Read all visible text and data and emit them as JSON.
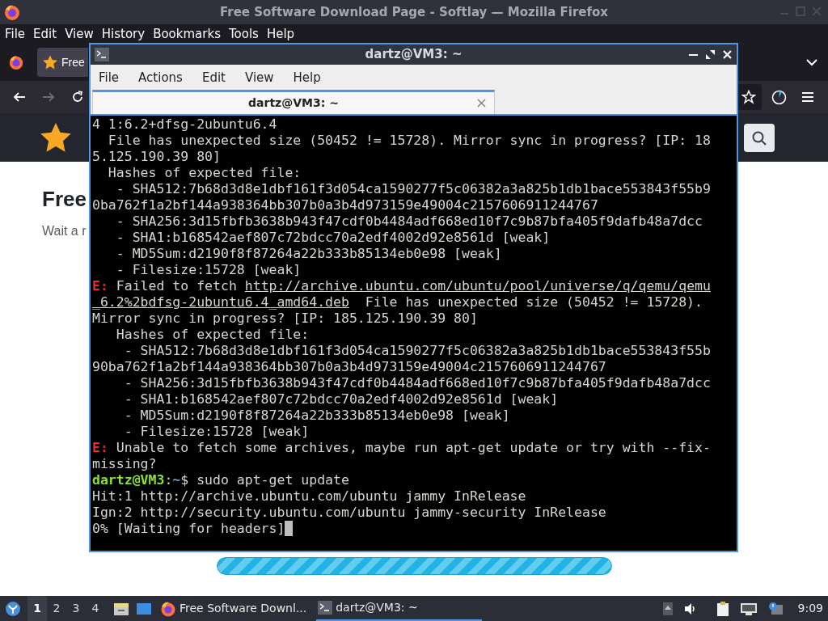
{
  "firefox": {
    "title": "Free Software Download Page - Softlay — Mozilla Firefox",
    "menu": [
      "File",
      "Edit",
      "View",
      "History",
      "Bookmarks",
      "Tools",
      "Help"
    ],
    "tab": {
      "label": "Free"
    },
    "page": {
      "heading": "Free",
      "text": "Wait a r",
      "progress": {
        "level": 1
      }
    }
  },
  "terminal": {
    "title": "dartz@VM3: ~",
    "menu": [
      "File",
      "Actions",
      "Edit",
      "View",
      "Help"
    ],
    "tabs": [
      {
        "label": "dartz@VM3: ~",
        "selected": true
      }
    ],
    "lines": [
      {
        "segments": [
          {
            "kind": "text",
            "text": "4 1:6.2+dfsg-2ubuntu6.4"
          }
        ]
      },
      {
        "segments": [
          {
            "kind": "text",
            "text": "  File has unexpected size (50452 != 15728). Mirror sync in progress? [IP: 18"
          }
        ]
      },
      {
        "segments": [
          {
            "kind": "text",
            "text": "5.125.190.39 80]"
          }
        ]
      },
      {
        "segments": [
          {
            "kind": "text",
            "text": "  Hashes of expected file:"
          }
        ]
      },
      {
        "segments": [
          {
            "kind": "text",
            "text": "   - SHA512:7b68d3d8e1dbf161f3d054ca1590277f5c06382a3a825b1db1bace553843f55b9"
          }
        ]
      },
      {
        "segments": [
          {
            "kind": "text",
            "text": "0ba762f1a2bf144a938364bb307b0a3b4d973159e49004c2157606911244767"
          }
        ]
      },
      {
        "segments": [
          {
            "kind": "text",
            "text": "   - SHA256:3d15fbfb3638b943f47cdf0b4484adf668ed10f7c9b87bfa405f9dafb48a7dcc"
          }
        ]
      },
      {
        "segments": [
          {
            "kind": "text",
            "text": "   - SHA1:b168542aef807c72bdcc70a2edf4002d92e8561d [weak]"
          }
        ]
      },
      {
        "segments": [
          {
            "kind": "text",
            "text": "   - MD5Sum:d2190f8f87264a22b333b85134eb0e98 [weak]"
          }
        ]
      },
      {
        "segments": [
          {
            "kind": "text",
            "text": "   - Filesize:15728 [weak]"
          }
        ]
      },
      {
        "segments": [
          {
            "kind": "error",
            "text": "E:"
          },
          {
            "kind": "text",
            "text": " Failed to fetch "
          },
          {
            "kind": "link",
            "text": "http://archive.ubuntu.com/ubuntu/pool/universe/q/qemu/qemu"
          }
        ]
      },
      {
        "segments": [
          {
            "kind": "link",
            "text": "_6.2%2bdfsg-2ubuntu6.4_amd64.deb"
          },
          {
            "kind": "text",
            "text": "  File has unexpected size (50452 != 15728)."
          }
        ]
      },
      {
        "segments": [
          {
            "kind": "text",
            "text": "Mirror sync in progress? [IP: 185.125.190.39 80]"
          }
        ]
      },
      {
        "segments": [
          {
            "kind": "text",
            "text": "   Hashes of expected file:"
          }
        ]
      },
      {
        "segments": [
          {
            "kind": "text",
            "text": "    - SHA512:7b68d3d8e1dbf161f3d054ca1590277f5c06382a3a825b1db1bace553843f55b"
          }
        ]
      },
      {
        "segments": [
          {
            "kind": "text",
            "text": "90ba762f1a2bf144a938364bb307b0a3b4d973159e49004c2157606911244767"
          }
        ]
      },
      {
        "segments": [
          {
            "kind": "text",
            "text": "    - SHA256:3d15fbfb3638b943f47cdf0b4484adf668ed10f7c9b87bfa405f9dafb48a7dcc"
          }
        ]
      },
      {
        "segments": [
          {
            "kind": "text",
            "text": "    - SHA1:b168542aef807c72bdcc70a2edf4002d92e8561d [weak]"
          }
        ]
      },
      {
        "segments": [
          {
            "kind": "text",
            "text": "    - MD5Sum:d2190f8f87264a22b333b85134eb0e98 [weak]"
          }
        ]
      },
      {
        "segments": [
          {
            "kind": "text",
            "text": "    - Filesize:15728 [weak]"
          }
        ]
      },
      {
        "segments": [
          {
            "kind": "error",
            "text": "E:"
          },
          {
            "kind": "text",
            "text": " Unable to fetch some archives, maybe run apt-get update or try with --fix-"
          }
        ]
      },
      {
        "segments": [
          {
            "kind": "text",
            "text": "missing?"
          }
        ]
      },
      {
        "segments": [
          {
            "kind": "user",
            "text": "dartz@VM3"
          },
          {
            "kind": "text",
            "text": ":"
          },
          {
            "kind": "path",
            "text": "~"
          },
          {
            "kind": "text",
            "text": "$ sudo apt-get update"
          }
        ]
      },
      {
        "segments": [
          {
            "kind": "text",
            "text": "Hit:1 http://archive.ubuntu.com/ubuntu jammy InRelease"
          }
        ]
      },
      {
        "segments": [
          {
            "kind": "text",
            "text": "Ign:2 http://security.ubuntu.com/ubuntu jammy-security InRelease"
          }
        ]
      },
      {
        "segments": [
          {
            "kind": "text",
            "text": "0% [Waiting for headers]"
          }
        ],
        "cursor": true
      }
    ]
  },
  "taskbar": {
    "workspaces": [
      {
        "label": "1",
        "selected": true
      },
      {
        "label": "2",
        "selected": false
      },
      {
        "label": "3",
        "selected": false
      },
      {
        "label": "4",
        "selected": false
      }
    ],
    "tasks": [
      {
        "kind": "browser",
        "label": "Free Software Downl...",
        "selected": false
      },
      {
        "kind": "terminal",
        "label": "dartz@VM3: ~",
        "selected": true
      }
    ],
    "clock": "9:09"
  }
}
